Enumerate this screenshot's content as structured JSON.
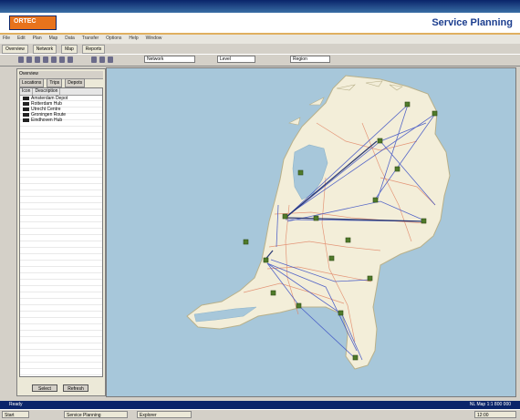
{
  "brand": {
    "logo_text": "ORTEC",
    "app_title": "Service Planning"
  },
  "menu": [
    "File",
    "Edit",
    "Plan",
    "Map",
    "Data",
    "Transfer",
    "Options",
    "Help",
    "Window"
  ],
  "tabs": [
    "Overview",
    "Network",
    "Map",
    "Reports"
  ],
  "toolbar": {
    "select1": "Network",
    "select2": "Level",
    "select3": "Region"
  },
  "panel": {
    "header": "Overview",
    "tabs": [
      "Locations",
      "Trips",
      "Depots"
    ],
    "columns": [
      "Icon",
      "Description"
    ],
    "items": [
      {
        "label": "Amsterdam Depot"
      },
      {
        "label": "Rotterdam Hub"
      },
      {
        "label": "Utrecht Centre"
      },
      {
        "label": "Groningen Route"
      },
      {
        "label": "Eindhoven Hub"
      }
    ],
    "buttons": [
      "Select",
      "Refresh"
    ]
  },
  "status": {
    "left": "Ready",
    "right": "NL Map 1:1 800 000"
  },
  "taskbar": {
    "start": "Start",
    "apps": [
      "Service Planning",
      "Explorer"
    ],
    "clock": "12:00"
  },
  "colors": {
    "water": "#a7c7da",
    "land": "#f3eed9",
    "route": "#3a4fc4",
    "road": "#e08060"
  }
}
